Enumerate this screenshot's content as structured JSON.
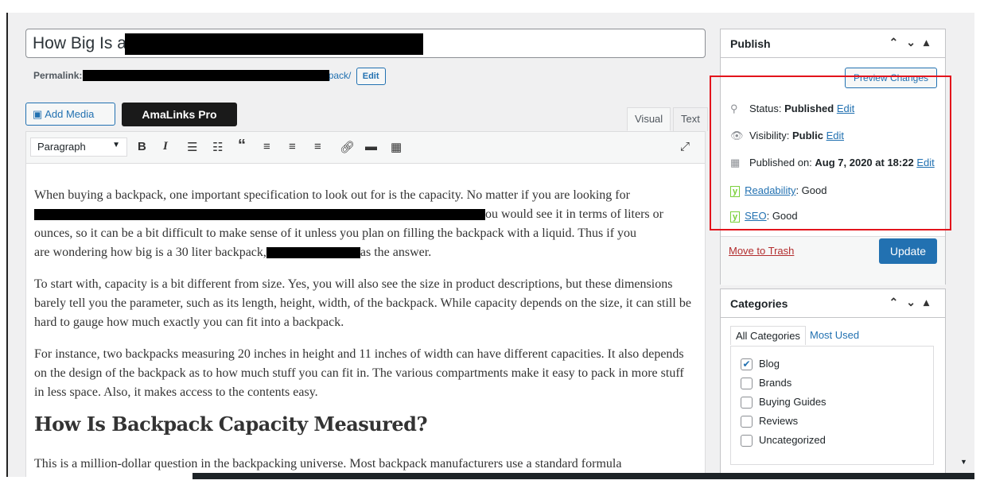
{
  "title": {
    "visible": "How Big Is a"
  },
  "permalink": {
    "label": "Permalink:",
    "visible_tail": "kpack/",
    "edit": "Edit"
  },
  "media": {
    "add_media": "Add Media",
    "amalinks": "AmaLinks Pro"
  },
  "tabs": {
    "visual": "Visual",
    "text": "Text"
  },
  "toolbar": {
    "format": "Paragraph",
    "icons": [
      "bold-icon",
      "italic-icon",
      "bulleted-list-icon",
      "numbered-list-icon",
      "blockquote-icon",
      "align-left-icon",
      "align-center-icon",
      "align-right-icon",
      "link-icon",
      "read-more-icon",
      "toolbar-toggle-icon",
      "fullscreen-icon"
    ]
  },
  "content": {
    "p1a": "When buying a backpack, one important specification to look out for is the capacity. No matter if you are looking for",
    "p1b": "ou would see it in terms of liters or",
    "p1c": "ounces, so it can be a bit difficult to make sense of it unless you plan on filling the backpack with a liquid. Thus if you",
    "p1d": "are wondering how big is a 30 liter backpack,",
    "p1e": "as the answer.",
    "p2": "To start with, capacity is a bit different from size. Yes, you will also see the size in product descriptions, but these dimensions barely tell you the parameter, such as its length, height, width, of the backpack. While capacity depends on the size, it can still be hard to gauge how much exactly you can fit into a backpack.",
    "p3": "For instance, two backpacks measuring 20 inches in height and 11 inches of width can have different capacities. It also depends on the design of the backpack as to how much stuff you can fit in. The various compartments make it easy to pack in more stuff in less space. Also, it makes access to the contents easy.",
    "h2": "How Is Backpack Capacity Measured?",
    "p4": "This is a million-dollar question in the backpacking universe. Most backpack manufacturers use a standard formula"
  },
  "publish": {
    "title": "Publish",
    "preview": "Preview Changes",
    "status_label": "Status:",
    "status": "Published",
    "visibility_label": "Visibility:",
    "visibility": "Public",
    "published_label": "Published on:",
    "published": "Aug 7, 2020 at 18:22",
    "edit": "Edit",
    "readability": "Readability",
    "readability_value": ": Good",
    "seo": "SEO",
    "seo_value": ": Good",
    "trash": "Move to Trash",
    "update": "Update"
  },
  "categories": {
    "title": "Categories",
    "tab_all": "All Categories",
    "tab_used": "Most Used",
    "items": [
      {
        "label": "Blog",
        "checked": true
      },
      {
        "label": "Brands",
        "checked": false
      },
      {
        "label": "Buying Guides",
        "checked": false
      },
      {
        "label": "Reviews",
        "checked": false
      },
      {
        "label": "Uncategorized",
        "checked": false
      }
    ]
  },
  "colors": {
    "accent": "#2271b1",
    "highlight": "#e3141c",
    "trash": "#b32d2e"
  }
}
